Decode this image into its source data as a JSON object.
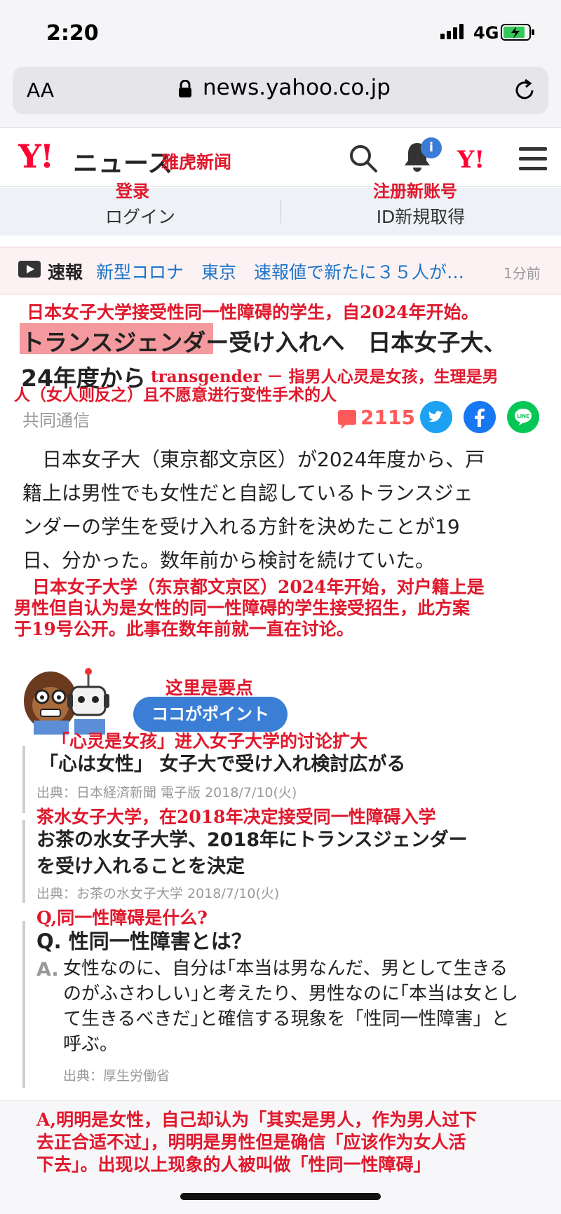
{
  "status": {
    "time": "2:20",
    "network": "4G"
  },
  "browser": {
    "text_size": "AA",
    "url": "news.yahoo.co.jp"
  },
  "header": {
    "logo": "Y!",
    "site_name": "ニュース",
    "site_name_annotation": "雅虎新闻",
    "notification_count": "i",
    "yahoo_icon": "Y!"
  },
  "account": {
    "login": "ログイン",
    "login_annotation": "登录",
    "register": "ID新規取得",
    "register_annotation": "注册新账号"
  },
  "breaking": {
    "label": "速報",
    "text": "新型コロナ　東京　速報値で新たに３５人が…",
    "time": "1分前"
  },
  "article": {
    "headline_annotation": "日本女子大学接受性同一性障碍的学生，自2024年开始。",
    "headline_line1": "トランスジェンダー受け入れへ　日本女子大、",
    "headline_line2": "24年度から",
    "transgender_annotation_line1": "transgender － 指男人心灵是女孩，生理是男",
    "transgender_annotation_line2": "人（女人则反之）且不愿意进行变性手术的人",
    "source": "共同通信",
    "comment_count": "2115",
    "body_lines": [
      "　日本女子大（東京都文京区）が2024年度から、戸",
      "籍上は男性でも女性だと自認しているトランスジェ",
      "ンダーの学生を受け入れる方針を決めたことが19",
      "日、分かった。数年前から検討を続けていた。"
    ],
    "body_annotation_lines": [
      "日本女子大学（东京都文京区）2024年开始，对户籍上是",
      "男性但自认为是女性的同一性障碍的学生接受招生，此方案",
      "于19号公开。此事在数年前就一直在讨论。"
    ]
  },
  "point": {
    "annotation": "这里是要点",
    "label": "ココがポイント",
    "item1_annotation": "「心灵是女孩」进入女子大学的讨论扩大",
    "item1_title": "「心は女性」 女子大で受け入れ検討広がる",
    "item1_source": "出典：日本経済新聞 電子版 2018/7/10(火)",
    "item2_annotation": "茶水女子大学，在2018年决定接受同一性障碍入学",
    "item2_title_line1": "お茶の水女子大学、2018年にトランスジェンダー",
    "item2_title_line2": "を受け入れることを決定",
    "item2_source": "出典：お茶の水女子大学 2018/7/10(火)",
    "q_annotation": "Q,同一性障碍是什么?",
    "question": "Q. 性同一性障害とは？",
    "a_label": "A.",
    "answer_lines": [
      "女性なのに、自分は｢本当は男なんだ、男として生きる",
      "のがふさわしい｣と考えたり、男性なのに｢本当は女とし",
      "て生きるべきだ｣と確信する現象を「性同一性障害」と",
      "呼ぶ。"
    ],
    "answer_source": "出典：厚生労働省",
    "answer_annotation_lines": [
      "A,明明是女性，自己却认为「其实是男人，作为男人过下",
      "去正合适不过」，明明是男性但是确信「应该作为女人活",
      "下去」。出现以上现象的人被叫做「性同一性障碍」"
    ]
  },
  "colors": {
    "annotation": "#e0182c",
    "yahoo_red": "#ff0033",
    "link_blue": "#1a73c8",
    "point_blue": "#3a7fd5"
  }
}
